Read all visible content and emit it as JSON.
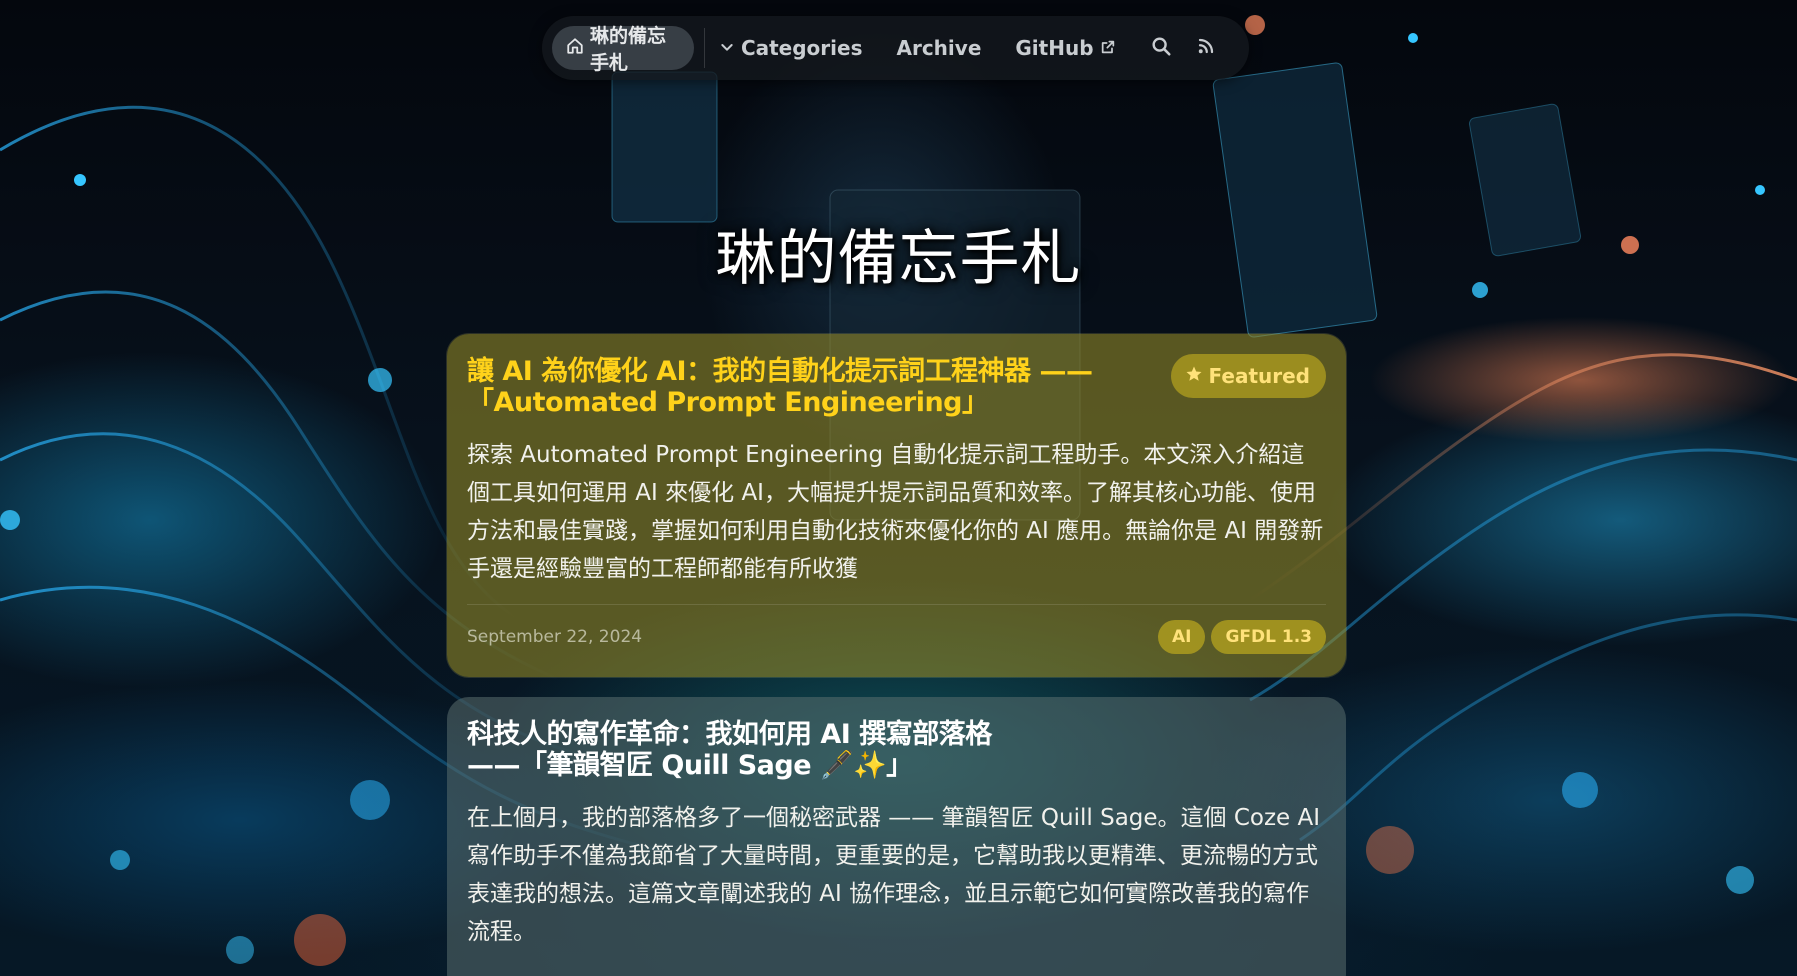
{
  "nav": {
    "home_label": "琳的備忘手札",
    "categories_label": "Categories",
    "archive_label": "Archive",
    "github_label": "GitHub"
  },
  "site": {
    "title": "琳的備忘手札"
  },
  "posts": [
    {
      "title": "讓 AI 為你優化 AI：我的自動化提示詞工程神器 ——「Automated Prompt Engineering」",
      "featured_label": "Featured",
      "excerpt": "探索 Automated Prompt Engineering 自動化提示詞工程助手。本文深入介紹這個工具如何運用 AI 來優化 AI，大幅提升提示詞品質和效率。了解其核心功能、使用方法和最佳實踐，掌握如何利用自動化技術來優化你的 AI 應用。無論你是 AI 開發新手還是經驗豐富的工程師都能有所收獲",
      "date": "September 22, 2024",
      "tags": [
        "AI",
        "GFDL 1.3"
      ]
    },
    {
      "title": "科技人的寫作革命：我如何用 AI 撰寫部落格 ——「筆韻智匠 Quill Sage 🖋️✨」",
      "excerpt": "在上個月，我的部落格多了一個秘密武器 —— 筆韻智匠 Quill Sage。這個 Coze AI 寫作助手不僅為我節省了大量時間，更重要的是，它幫助我以更精準、更流暢的方式表達我的想法。這篇文章闡述我的 AI 協作理念，並且示範它如何實際改善我的寫作流程。"
    }
  ],
  "colors": {
    "featured_title": "#ffd21a",
    "featured_card_bg": "rgba(150,140,40,0.58)",
    "regular_card_bg": "rgba(90,110,110,0.55)"
  },
  "icons": {
    "home": "home-icon",
    "categories": "chevron-down-icon",
    "github_external": "external-link-icon",
    "search": "search-icon",
    "rss": "rss-icon",
    "featured": "star-icon"
  }
}
